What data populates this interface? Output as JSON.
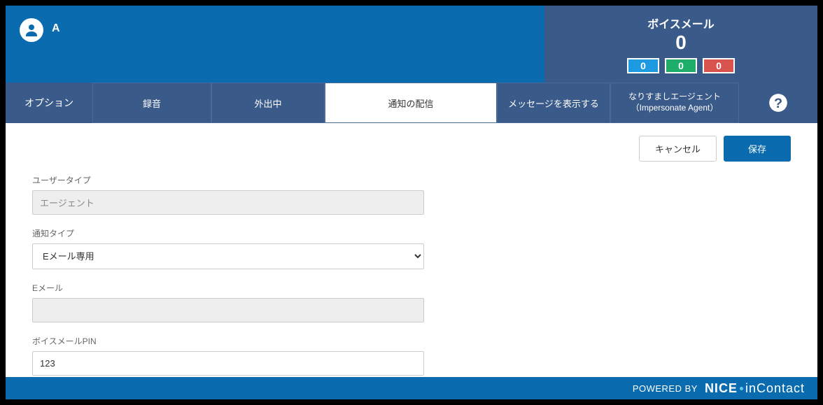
{
  "header": {
    "agent_name": "A",
    "voicemail_title": "ボイスメール",
    "voicemail_count": "0",
    "badges": {
      "blue": "0",
      "green": "0",
      "red": "0"
    }
  },
  "tabs": {
    "group_label": "オプション",
    "items": [
      {
        "label": "録音"
      },
      {
        "label": "外出中"
      },
      {
        "label": "通知の配信"
      },
      {
        "label": "メッセージを表示する"
      },
      {
        "label": "なりすましエージェント（Impersonate Agent）"
      }
    ]
  },
  "buttons": {
    "cancel": "キャンセル",
    "save": "保存"
  },
  "form": {
    "user_type_label": "ユーザータイプ",
    "user_type_value": "エージェント",
    "notify_type_label": "通知タイプ",
    "notify_type_value": "Eメール専用",
    "email_label": "Eメール",
    "email_value": "",
    "pin_label": "ボイスメールPIN",
    "pin_value": "123"
  },
  "footer": {
    "powered": "POWERED BY",
    "brand1": "NICE",
    "brand2": "inContact"
  }
}
